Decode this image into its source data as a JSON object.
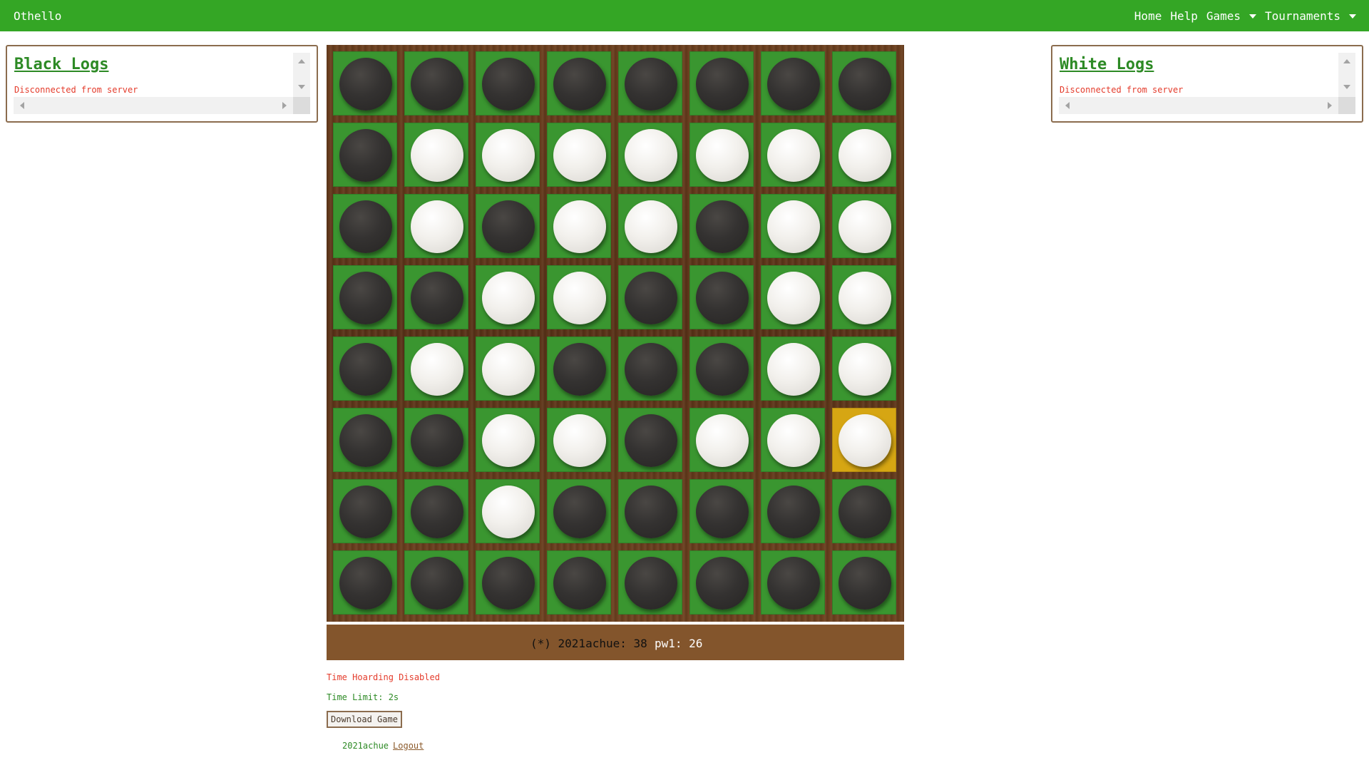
{
  "nav": {
    "brand": "Othello",
    "items": [
      {
        "label": "Home",
        "dropdown": false
      },
      {
        "label": "Help",
        "dropdown": false
      },
      {
        "label": "Games",
        "dropdown": true
      },
      {
        "label": "Tournaments",
        "dropdown": true
      }
    ]
  },
  "logs": {
    "black": {
      "title": "Black Logs",
      "message": "Disconnected from server"
    },
    "white": {
      "title": "White Logs",
      "message": "Disconnected from server"
    }
  },
  "board": {
    "rows": [
      "BBBBBBBB",
      "BWWWWWWW",
      "BWBWWBWW",
      "BBWWBBWW",
      "BWWBBBWW",
      "BBWWBWWW",
      "BBWBBBBB",
      "BBBBBBBB"
    ],
    "last_move": {
      "row": 5,
      "col": 7
    },
    "colors": {
      "square": "#3a9630",
      "highlight": "#d6a613",
      "frame": "#5e3719"
    }
  },
  "score": {
    "black_text": "(*) 2021achue: 38",
    "white_text": "pw1: 26"
  },
  "info": {
    "time_hoarding": "Time Hoarding Disabled",
    "time_limit": "Time Limit: 2s",
    "download_label": "Download Game"
  },
  "footer": {
    "user": "2021achue",
    "logout": "Logout"
  }
}
